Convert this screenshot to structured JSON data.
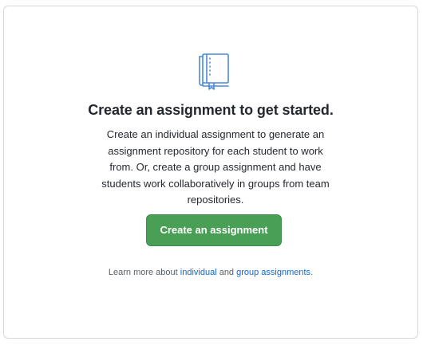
{
  "empty_state": {
    "icon": "repository-book-icon",
    "title": "Create an assignment to get started.",
    "description": "Create an individual assignment to generate an assignment repository for each student to work from. Or, create a group assignment and have students work collaboratively in groups from team repositories.",
    "button_label": "Create an assignment",
    "footer": {
      "prefix": "Learn more about ",
      "link1": "individual",
      "middle": " and ",
      "link2": "group assignments",
      "suffix": "."
    }
  },
  "colors": {
    "button": "#4a9f56",
    "link": "#0969da",
    "icon": "#4a89dc",
    "text": "#24292f"
  }
}
